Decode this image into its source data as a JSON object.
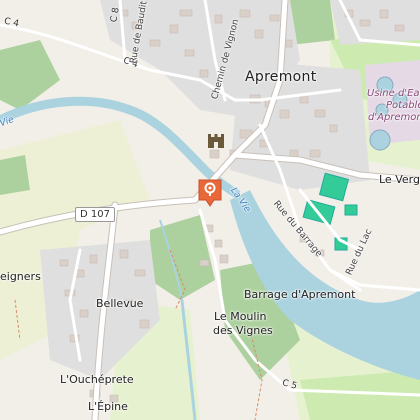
{
  "map": {
    "town_label": "Apremont",
    "places": {
      "bellevue": "Bellevue",
      "moulin_line1": "Le Moulin",
      "moulin_line2": "des Vignes",
      "ouchepre": "L'Ouchéprete",
      "epine": "L'Épine",
      "barrage": "Barrage d'Apremont",
      "verge": "Le Verge",
      "eigners": "eigners"
    },
    "roads": {
      "d107": "D 107",
      "c4": "C 4",
      "c8": "C 8",
      "c5": "C 5",
      "rue_baudit": "Rue de Baudit",
      "chemin_vignon": "Chemin de Vignon",
      "rue_barrage": "Rue du Barrage",
      "rue_lac": "Rue du Lac"
    },
    "water": {
      "la_vie": "La Vie",
      "vie_left": "Vie"
    },
    "poi": {
      "usine_line1": "Usine d'Eau",
      "usine_line2": "Potable",
      "usine_line3": "d'Apremont"
    },
    "marker_icon": "location-pin-icon",
    "colors": {
      "background": "#f2efe9",
      "water": "#aad3df",
      "river": "#aad3df",
      "forest": "#add19e",
      "meadow": "#cdebb0",
      "farmland": "#eef0d5",
      "residential": "#e0dfdf",
      "building": "#d9d0c9",
      "road": "#ffffff",
      "marker": "#e8683a",
      "sports": "#33cc99"
    }
  }
}
